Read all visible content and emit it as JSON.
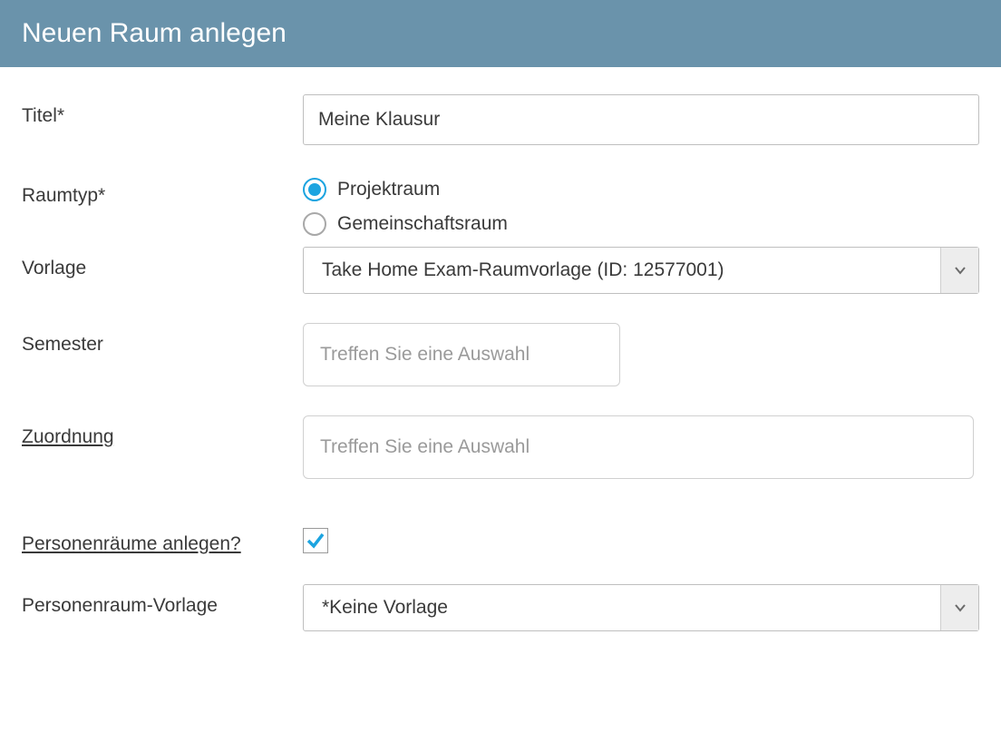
{
  "header": {
    "title": "Neuen Raum anlegen"
  },
  "form": {
    "titel": {
      "label": "Titel*",
      "value": "Meine Klausur"
    },
    "raumtyp": {
      "label": "Raumtyp*",
      "options": [
        {
          "label": "Projektraum",
          "checked": true
        },
        {
          "label": "Gemeinschaftsraum",
          "checked": false
        }
      ]
    },
    "vorlage": {
      "label": "Vorlage",
      "selected": "Take Home Exam-Raumvorlage (ID: 12577001)"
    },
    "semester": {
      "label": "Semester",
      "placeholder": "Treffen Sie eine Auswahl"
    },
    "zuordnung": {
      "label": "Zuordnung",
      "placeholder": "Treffen Sie eine Auswahl"
    },
    "personenraeume": {
      "label": "Personenräume anlegen?",
      "checked": true
    },
    "personenraum_vorlage": {
      "label": "Personenraum-Vorlage",
      "selected": "*Keine Vorlage"
    }
  }
}
